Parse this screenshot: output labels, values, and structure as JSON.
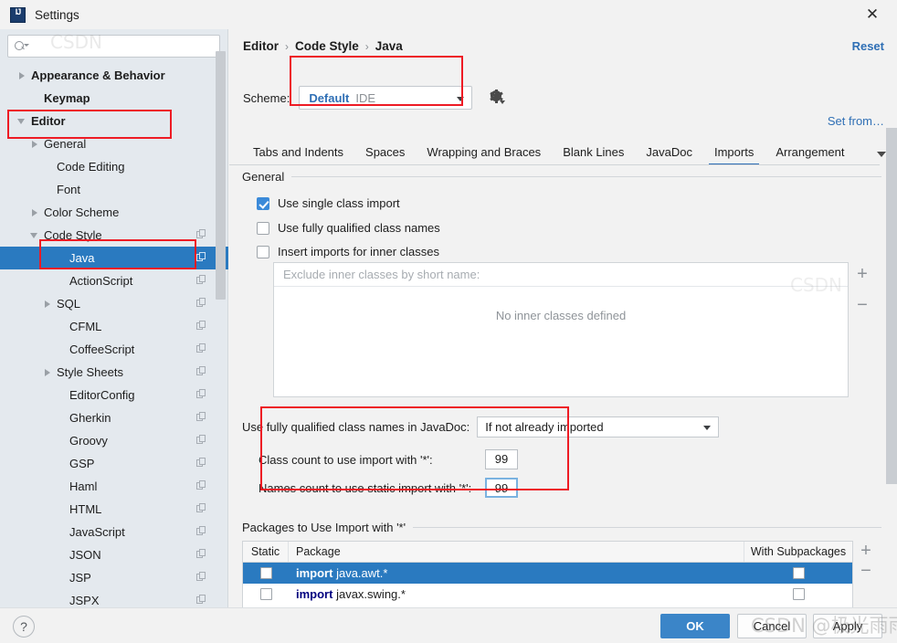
{
  "window": {
    "title": "Settings",
    "logo_icon": "intellij-idea-logo",
    "close_icon": "✕"
  },
  "sidebar": {
    "search": {
      "value": "",
      "placeholder": "",
      "icon": "search-icon"
    },
    "items": [
      {
        "label": "Appearance & Behavior",
        "indent": 1,
        "twisty": "closed",
        "bold": true,
        "selected": false,
        "copy": false
      },
      {
        "label": "Keymap",
        "indent": 2,
        "twisty": "none",
        "bold": true,
        "selected": false,
        "copy": false
      },
      {
        "label": "Editor",
        "indent": 1,
        "twisty": "open",
        "bold": true,
        "selected": false,
        "copy": false
      },
      {
        "label": "General",
        "indent": 2,
        "twisty": "closed",
        "bold": false,
        "selected": false,
        "copy": false
      },
      {
        "label": "Code Editing",
        "indent": 3,
        "twisty": "none",
        "bold": false,
        "selected": false,
        "copy": false
      },
      {
        "label": "Font",
        "indent": 3,
        "twisty": "none",
        "bold": false,
        "selected": false,
        "copy": false
      },
      {
        "label": "Color Scheme",
        "indent": 2,
        "twisty": "closed",
        "bold": false,
        "selected": false,
        "copy": false
      },
      {
        "label": "Code Style",
        "indent": 2,
        "twisty": "open",
        "bold": false,
        "selected": false,
        "copy": true
      },
      {
        "label": "Java",
        "indent": 4,
        "twisty": "none",
        "bold": false,
        "selected": true,
        "copy": true
      },
      {
        "label": "ActionScript",
        "indent": 4,
        "twisty": "none",
        "bold": false,
        "selected": false,
        "copy": true
      },
      {
        "label": "SQL",
        "indent": 3,
        "twisty": "closed",
        "bold": false,
        "selected": false,
        "copy": true
      },
      {
        "label": "CFML",
        "indent": 4,
        "twisty": "none",
        "bold": false,
        "selected": false,
        "copy": true
      },
      {
        "label": "CoffeeScript",
        "indent": 4,
        "twisty": "none",
        "bold": false,
        "selected": false,
        "copy": true
      },
      {
        "label": "Style Sheets",
        "indent": 3,
        "twisty": "closed",
        "bold": false,
        "selected": false,
        "copy": true
      },
      {
        "label": "EditorConfig",
        "indent": 4,
        "twisty": "none",
        "bold": false,
        "selected": false,
        "copy": true
      },
      {
        "label": "Gherkin",
        "indent": 4,
        "twisty": "none",
        "bold": false,
        "selected": false,
        "copy": true
      },
      {
        "label": "Groovy",
        "indent": 4,
        "twisty": "none",
        "bold": false,
        "selected": false,
        "copy": true
      },
      {
        "label": "GSP",
        "indent": 4,
        "twisty": "none",
        "bold": false,
        "selected": false,
        "copy": true
      },
      {
        "label": "Haml",
        "indent": 4,
        "twisty": "none",
        "bold": false,
        "selected": false,
        "copy": true
      },
      {
        "label": "HTML",
        "indent": 4,
        "twisty": "none",
        "bold": false,
        "selected": false,
        "copy": true
      },
      {
        "label": "JavaScript",
        "indent": 4,
        "twisty": "none",
        "bold": false,
        "selected": false,
        "copy": true
      },
      {
        "label": "JSON",
        "indent": 4,
        "twisty": "none",
        "bold": false,
        "selected": false,
        "copy": true
      },
      {
        "label": "JSP",
        "indent": 4,
        "twisty": "none",
        "bold": false,
        "selected": false,
        "copy": true
      },
      {
        "label": "JSPX",
        "indent": 4,
        "twisty": "none",
        "bold": false,
        "selected": false,
        "copy": true
      }
    ]
  },
  "main": {
    "breadcrumb": {
      "part1": "Editor",
      "sep1": "›",
      "part2": "Code Style",
      "sep2": "›",
      "part3": "Java"
    },
    "reset_label": "Reset",
    "scheme": {
      "label": "Scheme:",
      "value": "Default",
      "scope": "IDE",
      "gear_icon": "gear-icon"
    },
    "set_from_label": "Set from…",
    "tabs": [
      {
        "label": "Tabs and Indents",
        "active": false
      },
      {
        "label": "Spaces",
        "active": false
      },
      {
        "label": "Wrapping and Braces",
        "active": false
      },
      {
        "label": "Blank Lines",
        "active": false
      },
      {
        "label": "JavaDoc",
        "active": false
      },
      {
        "label": "Imports",
        "active": true
      },
      {
        "label": "Arrangement",
        "active": false
      }
    ],
    "general": {
      "title": "General",
      "checkboxes": [
        {
          "label": "Use single class import",
          "checked": true
        },
        {
          "label": "Use fully qualified class names",
          "checked": false
        },
        {
          "label": "Insert imports for inner classes",
          "checked": false
        }
      ],
      "exclude_list": {
        "placeholder": "Exclude inner classes by short name:",
        "empty_message": "No inner classes defined",
        "add_label": "+",
        "remove_label": "−"
      },
      "javadoc": {
        "label": "Use fully qualified class names in JavaDoc:",
        "value": "If not already imported"
      },
      "class_count": {
        "label": "Class count to use import with '*':",
        "value": "99"
      },
      "names_count": {
        "label": "Names count to use static import with '*':",
        "value": "99"
      }
    },
    "packages": {
      "title": "Packages to Use Import with '*'",
      "columns": [
        "Static",
        "Package",
        "With Subpackages"
      ],
      "rows": [
        {
          "static": false,
          "keyword": "import",
          "package": "java.awt.*",
          "subpackages": false,
          "selected": true
        },
        {
          "static": false,
          "keyword": "import",
          "package": "javax.swing.*",
          "subpackages": false,
          "selected": false
        }
      ],
      "add_label": "+",
      "remove_label": "−"
    }
  },
  "footer": {
    "help_label": "?",
    "ok_label": "OK",
    "cancel_label": "Cancel",
    "apply_label": "Apply"
  },
  "watermark": {
    "text": "CSDN @极光雨雨",
    "faint1": "CSDN",
    "faint2": "CSDN"
  },
  "colors": {
    "accent_blue": "#2a7ac0",
    "link_blue": "#2f6fb5",
    "annotation_red": "#ee1b24",
    "sidebar_bg": "#e4e9ee",
    "panel_bg": "#f2f2f2",
    "keyword_navy": "#00007f"
  }
}
